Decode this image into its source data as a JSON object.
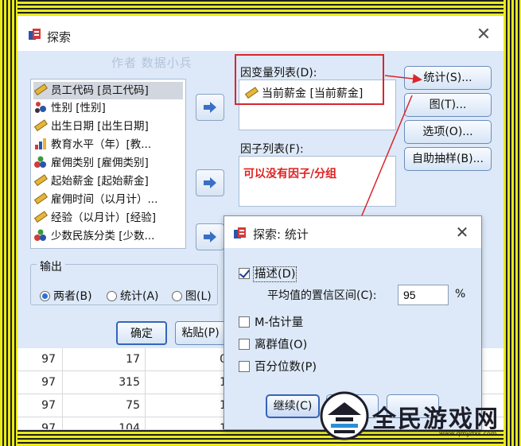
{
  "main_dialog": {
    "title": "探索",
    "watermark": "作者 数据小兵",
    "variables": [
      {
        "icon": "scale-ruler-icon",
        "label": "员工代码 [员工代码]"
      },
      {
        "icon": "nominal-person-icon",
        "label": "性别 [性别]"
      },
      {
        "icon": "scale-ruler-icon",
        "label": "出生日期 [出生日期]"
      },
      {
        "icon": "ordinal-bar-icon",
        "label": "教育水平（年）[教..."
      },
      {
        "icon": "nominal-balls-icon",
        "label": "雇佣类别 [雇佣类别]"
      },
      {
        "icon": "scale-ruler-icon",
        "label": "起始薪金 [起始薪金]"
      },
      {
        "icon": "scale-ruler-icon",
        "label": "雇佣时间（以月计）..."
      },
      {
        "icon": "scale-ruler-icon",
        "label": "经验（以月计）[经验]"
      },
      {
        "icon": "nominal-balls-icon",
        "label": "少数民族分类 [少数..."
      }
    ],
    "dependent_label": "因变量列表(D):",
    "dependent_items": [
      "当前薪金 [当前薪金]"
    ],
    "factor_label": "因子列表(F):",
    "factor_annotation": "可以没有因子/分组",
    "side_buttons": [
      "统计(S)...",
      "图(T)...",
      "选项(O)...",
      "自助抽样(B)..."
    ],
    "output": {
      "title": "输出",
      "options": [
        "两者(B)",
        "统计(A)",
        "图(L)"
      ],
      "selected": "两者(B)"
    },
    "bottom_buttons": [
      "确定",
      "粘贴(P)"
    ]
  },
  "background_table": {
    "rows": [
      [
        "97",
        "17",
        "0"
      ],
      [
        "97",
        "315",
        "1"
      ],
      [
        "97",
        "75",
        "1"
      ],
      [
        "97",
        "104",
        "1"
      ]
    ]
  },
  "stats_dialog": {
    "title": "探索: 统计",
    "descriptives": {
      "label": "描述(D)",
      "checked": true
    },
    "ci_label": "平均值的置信区间(C):",
    "ci_value": "95",
    "ci_unit": "%",
    "m_estimators": {
      "label": "M-估计量",
      "checked": false
    },
    "outliers": {
      "label": "离群值(O)",
      "checked": false
    },
    "percentiles": {
      "label": "百分位数(P)",
      "checked": false
    },
    "continue_label": "继续(C)"
  },
  "logo": {
    "name": "全民游戏网",
    "url": "www.qmydxs.com"
  },
  "colors": {
    "dialog_bg": "#dde9f8",
    "annotation_red": "#d9262b",
    "frame_yellow": "#e8ea1c"
  }
}
